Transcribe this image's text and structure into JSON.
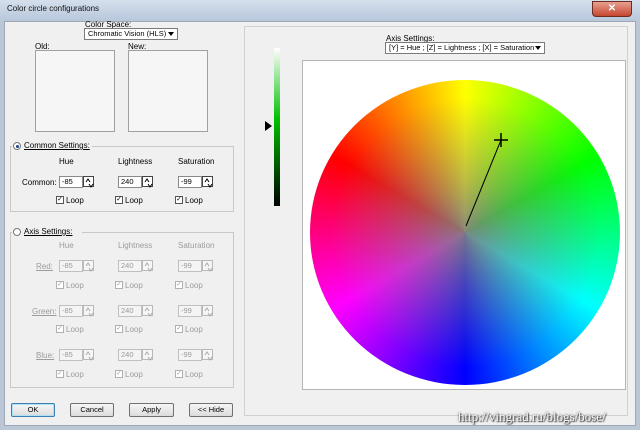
{
  "window": {
    "title": "Color circle configurations",
    "close_glyph": "✕"
  },
  "color_space": {
    "label": "Color Space:",
    "value": "Chromatic Vision (HLS)"
  },
  "swatches": {
    "old_label": "Old:",
    "new_label": "New:"
  },
  "common": {
    "label": "Common Settings:",
    "selected": true,
    "headers": [
      "Hue",
      "Lightness",
      "Saturation"
    ],
    "row_label": "Common:",
    "values": [
      "-85",
      "240",
      "-99"
    ],
    "loop_label": "Loop",
    "loops": [
      true,
      true,
      true
    ]
  },
  "axis": {
    "label": "Axis Settings:",
    "selected": false,
    "headers": [
      "Hue",
      "Lightness",
      "Saturation"
    ],
    "rows": [
      {
        "label": "Red:",
        "values": [
          "-85",
          "240",
          "-99"
        ]
      },
      {
        "label": "Green:",
        "values": [
          "-85",
          "240",
          "-99"
        ]
      },
      {
        "label": "Blue:",
        "values": [
          "-85",
          "240",
          "-99"
        ]
      }
    ],
    "loop_label": "Loop"
  },
  "buttons": {
    "ok": "OK",
    "cancel": "Cancel",
    "apply": "Apply",
    "hide": "<< Hide"
  },
  "wheel_panel": {
    "axis_label": "Axis Settings:",
    "axis_value": "[Y] = Hue ; [Z] = Lightness ; [X] = Saturation"
  },
  "watermark": "http://vingrad.ru/blogs/bose/",
  "colors": {
    "accent": "#3c7fb1",
    "selected_radio": "#1a3f8c"
  }
}
